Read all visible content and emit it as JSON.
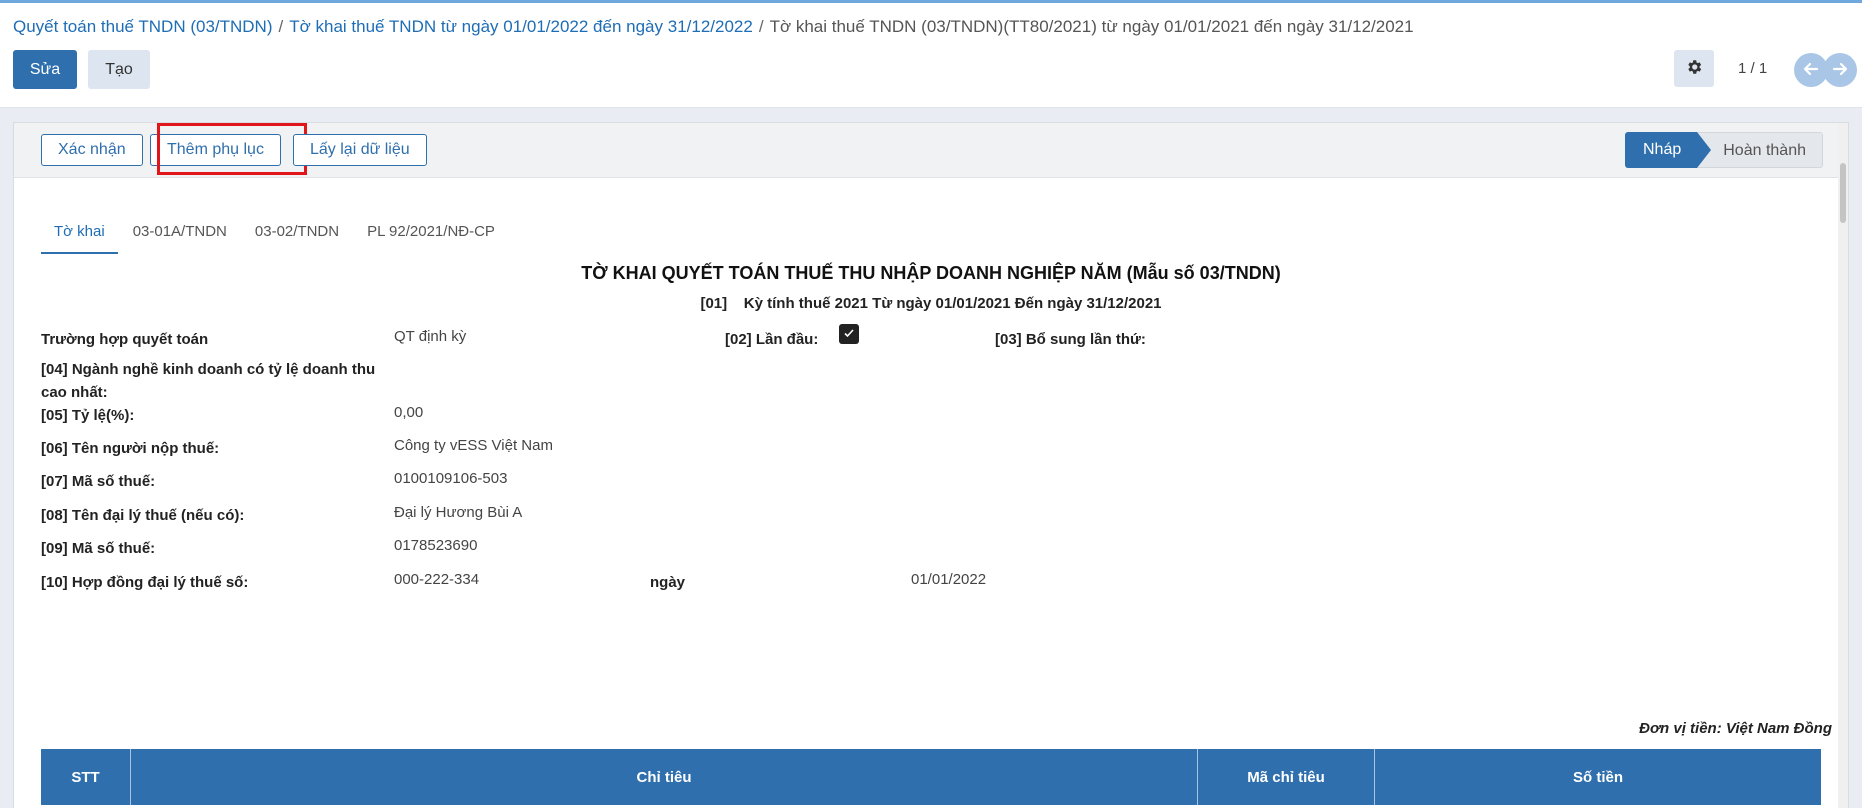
{
  "breadcrumb": {
    "item1": "Quyết toán thuế TNDN (03/TNDN)",
    "item2": "Tờ khai thuế TNDN từ ngày 01/01/2022 đến ngày 31/12/2022",
    "current": "Tờ khai thuế TNDN (03/TNDN)(TT80/2021) từ ngày 01/01/2021 đến ngày 31/12/2021"
  },
  "toolbar": {
    "edit_label": "Sửa",
    "create_label": "Tạo",
    "pager": "1 / 1"
  },
  "statusbar": {
    "confirm_label": "Xác nhận",
    "add_appendix_label": "Thêm phụ lục",
    "reload_label": "Lấy lại dữ liệu",
    "stages": {
      "draft": "Nháp",
      "done": "Hoàn thành"
    }
  },
  "tabs": [
    "Tờ khai",
    "03-01A/TNDN",
    "03-02/TNDN",
    "PL 92/2021/NĐ-CP"
  ],
  "form": {
    "title": "TỜ KHAI QUYẾT TOÁN THUẾ THU NHẬP DOANH NGHIỆP NĂM (Mẫu số 03/TNDN)",
    "period": "[01]    Kỳ tính thuế 2021 Từ ngày 01/01/2021 Đến ngày 31/12/2021",
    "first_time_label": "[02] Lần đầu:",
    "first_time_checked": true,
    "supplement_label": "[03] Bổ sung lần thứ:",
    "fields": [
      {
        "label": "Trường hợp quyết toán",
        "value": "QT định kỳ"
      },
      {
        "label": "[04] Ngành nghề kinh doanh có tỷ lệ doanh thu cao nhất:",
        "value": ""
      },
      {
        "label": "[05] Tỷ lệ(%):",
        "value": "0,00"
      },
      {
        "label": "[06] Tên người nộp thuế:",
        "value": "Công ty vESS Việt Nam"
      },
      {
        "label": "[07] Mã số thuế:",
        "value": "0100109106-503"
      },
      {
        "label": "[08] Tên đại lý thuế (nếu có):",
        "value": "Đại lý Hương Bùi A"
      },
      {
        "label": "[09] Mã số thuế:",
        "value": "0178523690"
      },
      {
        "label": "[10] Hợp đồng đại lý thuế số:",
        "value": "000-222-334"
      }
    ],
    "contract_date_label": "ngày",
    "contract_date": "01/01/2022",
    "unit": "Đơn vị tiền: Việt Nam Đồng"
  },
  "table": {
    "columns": [
      "STT",
      "Chỉ tiêu",
      "Mã chỉ tiêu",
      "Số tiền"
    ]
  },
  "colors": {
    "primary": "#2f6fad",
    "highlight": "#e0161b"
  }
}
